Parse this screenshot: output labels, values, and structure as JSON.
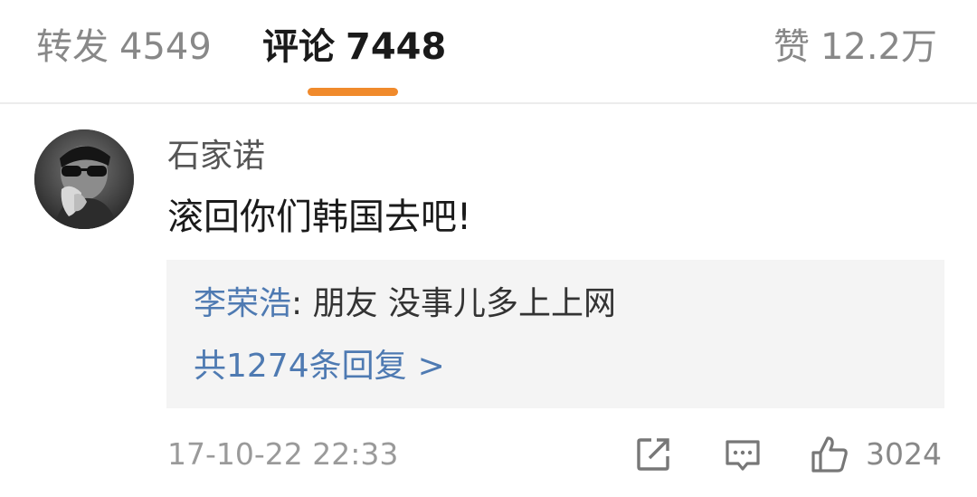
{
  "tabs": {
    "repost": {
      "label": "转发",
      "count": "4549"
    },
    "comment": {
      "label": "评论",
      "count": "7448"
    },
    "like": {
      "label": "赞",
      "count": "12.2万"
    }
  },
  "comment": {
    "username": "石家诺",
    "text": "滚回你们韩国去吧!",
    "reply": {
      "author": "李荣浩",
      "separator": ":",
      "text": "朋友 没事儿多上上网",
      "more_label": "共1274条回复",
      "more_chevron": ">"
    },
    "timestamp": "17-10-22 22:33",
    "like_count": "3024"
  },
  "icons": {
    "share": "share-icon",
    "comment": "comment-icon",
    "like": "thumbs-up-icon"
  },
  "colors": {
    "accent": "#f08a2c",
    "link": "#4e7ab2",
    "muted": "#888888"
  }
}
